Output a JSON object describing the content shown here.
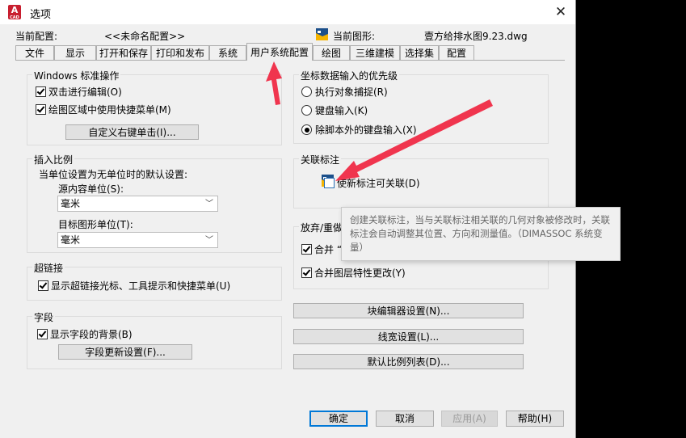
{
  "window": {
    "title": "选项"
  },
  "header": {
    "profile_label": "当前配置:",
    "profile_value": "<<未命名配置>>",
    "drawing_label": "当前图形:",
    "drawing_value": "壹方给排水图9.23.dwg"
  },
  "tabs": [
    "文件",
    "显示",
    "打开和保存",
    "打印和发布",
    "系统",
    "用户系统配置",
    "绘图",
    "三维建模",
    "选择集",
    "配置"
  ],
  "active_tab": "用户系统配置",
  "windows_ops": {
    "title": "Windows 标准操作",
    "double_click_edit": "双击进行编辑(O)",
    "shortcut_menu": "绘图区域中使用快捷菜单(M)",
    "custom_right_click_button": "自定义右键单击(I)..."
  },
  "insert_scale": {
    "title": "插入比例",
    "subtitle": "当单位设置为无单位时的默认设置:",
    "source_label": "源内容单位(S):",
    "source_value": "毫米",
    "target_label": "目标图形单位(T):",
    "target_value": "毫米"
  },
  "hyperlink": {
    "title": "超链接",
    "show_cursor": "显示超链接光标、工具提示和快捷菜单(U)"
  },
  "fields": {
    "title": "字段",
    "show_background": "显示字段的背景(B)",
    "update_settings_button": "字段更新设置(F)..."
  },
  "coord_priority": {
    "title": "坐标数据输入的优先级",
    "option1": "执行对象捕捉(R)",
    "option2": "键盘输入(K)",
    "option3": "除脚本外的键盘输入(X)"
  },
  "assoc_dim": {
    "title": "关联标注",
    "make_new_assoc": "使新标注可关联(D)"
  },
  "undo_redo": {
    "title": "放弃/重做",
    "combine_zoom": "合并 “",
    "combine_layer": "合并图层特性更改(Y)"
  },
  "buttons": {
    "block_editor": "块编辑器设置(N)...",
    "lineweight": "线宽设置(L)...",
    "scale_list": "默认比例列表(D)...",
    "ok": "确定",
    "cancel": "取消",
    "apply": "应用(A)",
    "help": "帮助(H)"
  },
  "tooltip": {
    "text": "创建关联标注，当与关联标注相关联的几何对象被修改时，关联标注会自动调整其位置、方向和测量值。（DIMASSOC 系统变量）"
  },
  "colors": {
    "arrow": "#f0354e",
    "accent": "#0078d7"
  }
}
